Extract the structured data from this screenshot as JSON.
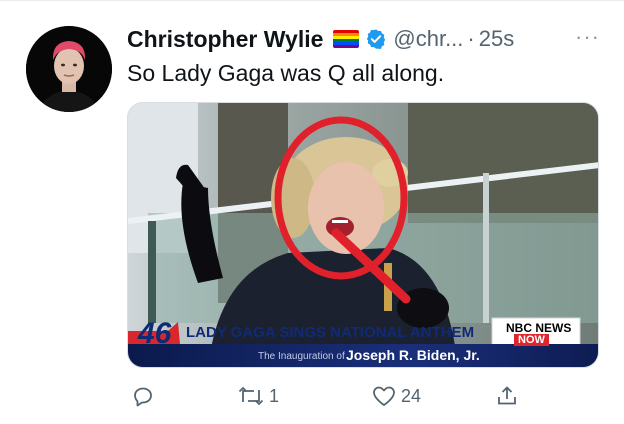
{
  "tweet": {
    "author": {
      "display_name": "Christopher Wylie",
      "handle": "@chr...",
      "separator": "·",
      "time": "25s",
      "more": "···"
    },
    "text": "So Lady Gaga was Q all along.",
    "media": {
      "chyron": {
        "number": "46",
        "headline": "LADY GAGA SINGS NATIONAL ANTHEM",
        "network": "NBC NEWS",
        "now": "NOW",
        "sub_small": "The Inauguration of",
        "sub_big": "Joseph R. Biden, Jr."
      }
    },
    "actions": {
      "reply_icon": "reply-icon",
      "retweet_icon": "retweet-icon",
      "retweet_count": "1",
      "like_icon": "heart-icon",
      "like_count": "24",
      "share_icon": "share-icon"
    }
  },
  "colors": {
    "verified": "#1d9bf0",
    "secondary_text": "#536471",
    "annotation_red": "#e0202a"
  }
}
